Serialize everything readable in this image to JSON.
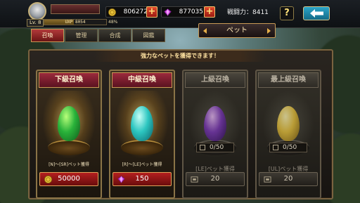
{
  "player": {
    "level_label": "Lv. 8",
    "exp_text": "UXP 8054",
    "exp_percent_text": "48%",
    "exp_fraction": 0.48
  },
  "currencies": {
    "gold": "806272",
    "gems": "877035"
  },
  "power_label": "戦闘力：8411",
  "help_label": "?",
  "tabs": [
    "召喚",
    "管理",
    "合成",
    "図鑑"
  ],
  "active_tab": 0,
  "screen_title": "ペット",
  "banner": "強力なペットを獲得できます！",
  "cards": [
    {
      "title": "下級召喚",
      "subtitle": "[N]～[SR]ペット獲得",
      "cost": "50000",
      "cost_icon": "gold-coin-icon",
      "egg_colors": [
        "#b8ff7a",
        "#29b23a",
        "#0f5a1b"
      ],
      "locked": false
    },
    {
      "title": "中級召喚",
      "subtitle": "[R]～[LE]ペット獲得",
      "cost": "150",
      "cost_icon": "gem-icon",
      "egg_colors": [
        "#c8fff7",
        "#2cc6c0",
        "#0b5e66"
      ],
      "locked": false
    },
    {
      "title": "上級召喚",
      "count": "0/50",
      "subtitle": "[LE]ペット獲得",
      "cost": "20",
      "cost_icon": "ticket-icon",
      "egg_colors": [
        "#f0b8ff",
        "#8a3ad0",
        "#3b1466"
      ],
      "locked": true
    },
    {
      "title": "最上級召喚",
      "count": "0/50",
      "subtitle": "[UL]ペット獲得",
      "cost": "20",
      "cost_icon": "ticket-icon",
      "egg_colors": [
        "#fff3a0",
        "#f0c323",
        "#8a6608"
      ],
      "locked": true
    }
  ]
}
